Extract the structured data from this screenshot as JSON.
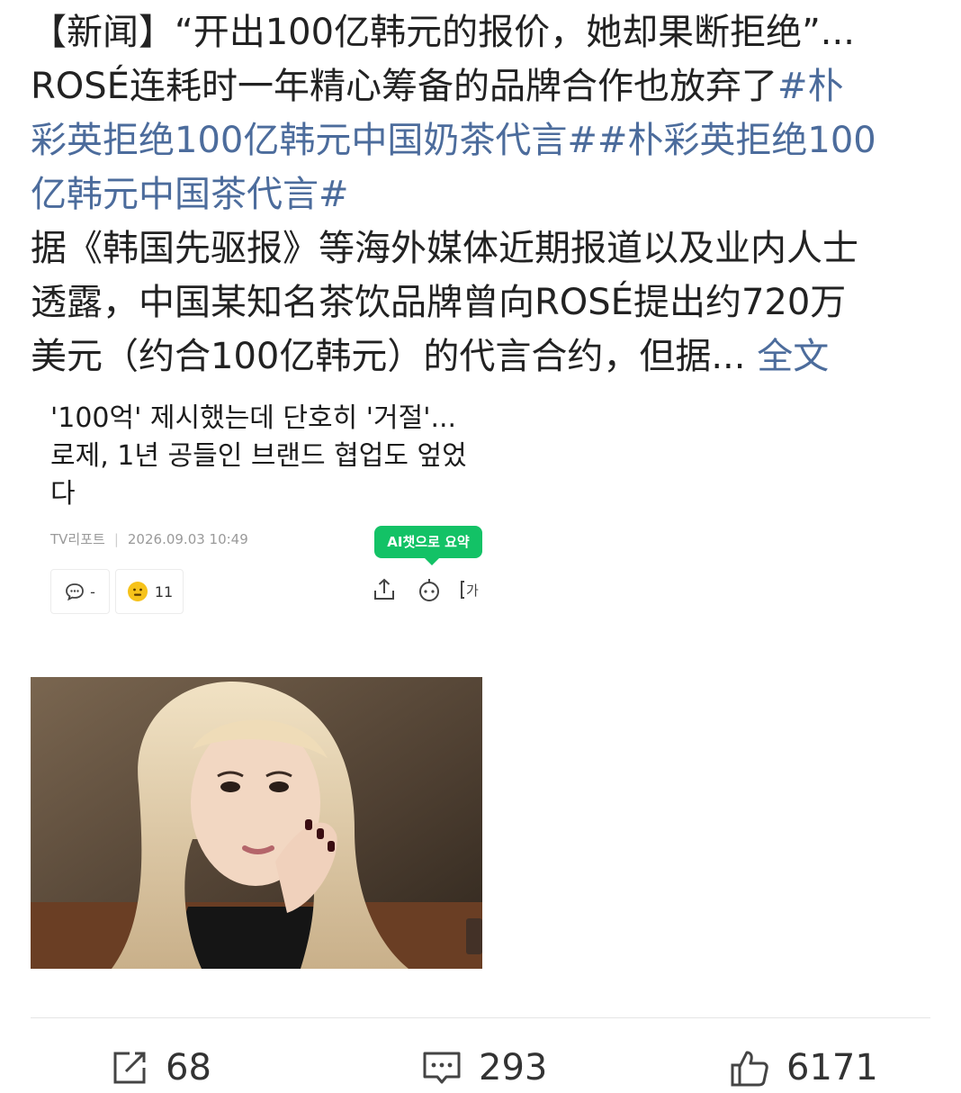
{
  "post": {
    "line1_prefix": "【新闻】“开出100亿韩元的报价，她却果断拒绝”...",
    "line2_text": "ROSÉ连耗时一年精心筹备的品牌合作也放弃了",
    "line2_tag": "#朴",
    "line3_tag": "彩英拒绝100亿韩元中国奶茶代言##朴彩英拒绝100",
    "line4_tag": "亿韩元中国茶代言#",
    "line5": "据《韩国先驱报》等海外媒体近期报道以及业内人士",
    "line6": "透露，中国某知名茶饮品牌曾向ROSÉ提出约720万",
    "line7": "美元（约合100亿韩元）的代言合约，但据...",
    "more_label": "全文"
  },
  "article": {
    "headline_line1": "'100억' 제시했는데 단호히 '거절'...",
    "headline_line2": "로제, 1년 공들인 브랜드 협업도 엎었",
    "headline_line3": "다",
    "source": "TV리포트",
    "date": "2026.09.03 10:49",
    "ai_summary_label": "AI챗으로 요약",
    "comment_count": "-",
    "reaction_count": "11"
  },
  "actions": {
    "share_count": "68",
    "comment_count": "293",
    "like_count": "6171"
  },
  "colors": {
    "link": "#4c6c9c",
    "text": "#222222",
    "ai_green": "#13c266"
  }
}
